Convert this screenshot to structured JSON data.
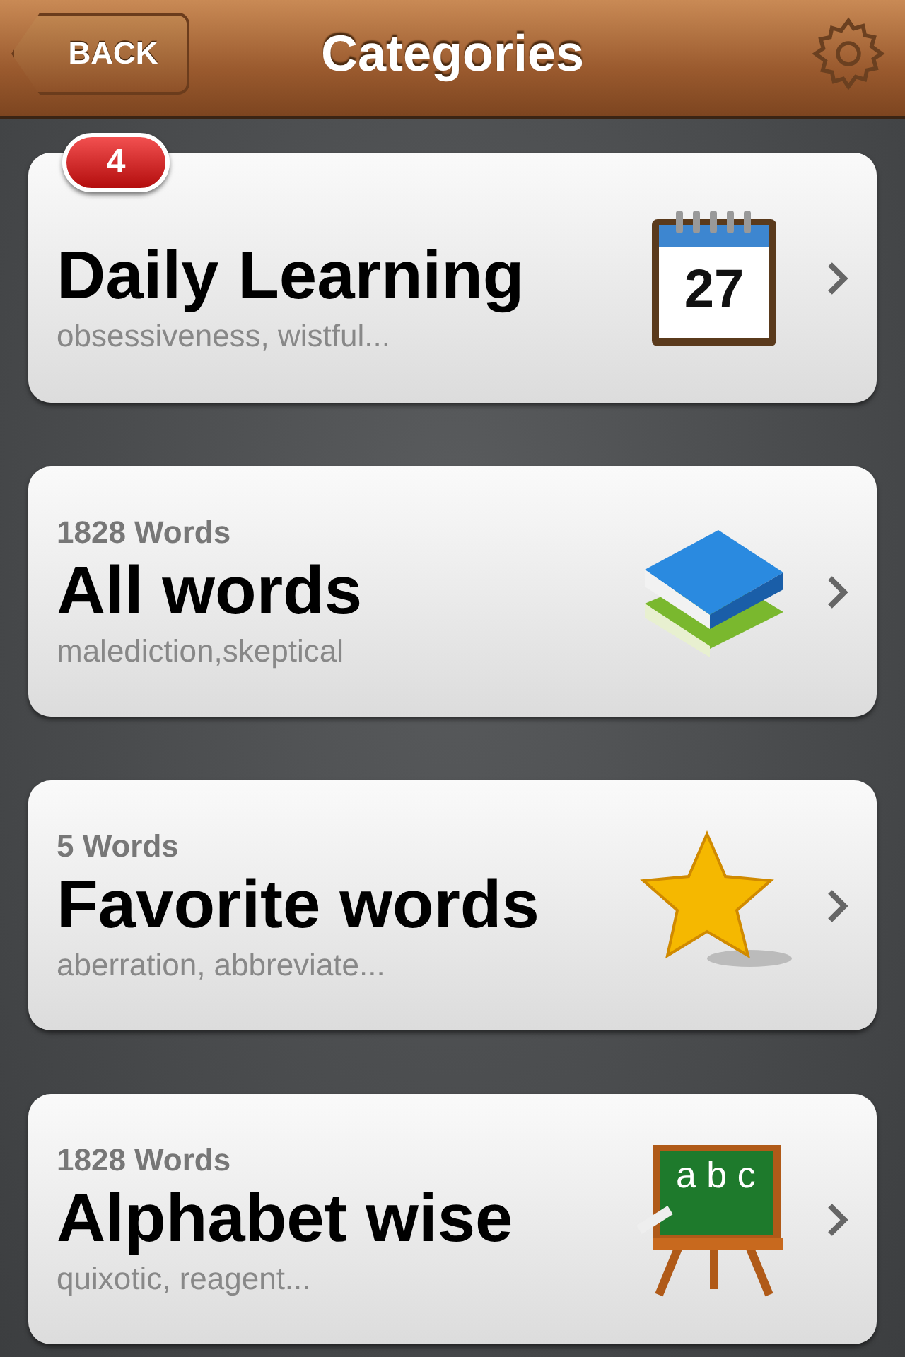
{
  "nav_bar": {
    "back_label": "BACK",
    "title": "Categories"
  },
  "categories": [
    {
      "kind": "calendar",
      "badge": "4",
      "title": "Daily Learning",
      "subtitle": "obsessiveness, wistful...",
      "icon_text": "27"
    },
    {
      "kind": "books",
      "count": "1828 Words",
      "title": "All words",
      "subtitle": "malediction,skeptical"
    },
    {
      "kind": "star",
      "count": "5 Words",
      "title": "Favorite words",
      "subtitle": "aberration, abbreviate..."
    },
    {
      "kind": "chalkboard",
      "count": "1828 Words",
      "title": "Alphabet wise",
      "subtitle": "quixotic, reagent...",
      "icon_text": "a b c"
    }
  ]
}
